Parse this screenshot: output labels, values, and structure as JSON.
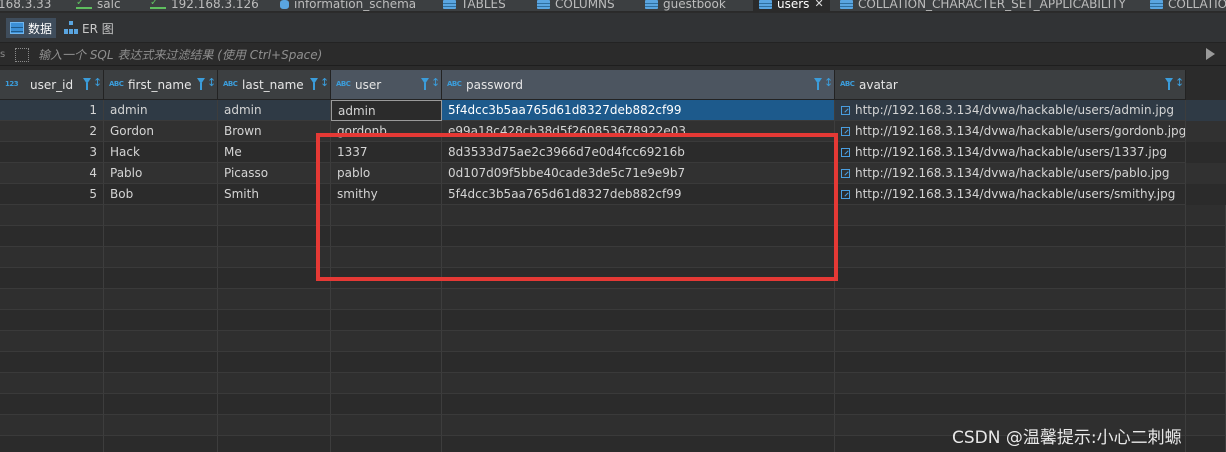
{
  "tabs": [
    {
      "label": "168.3.33",
      "icon": "connection-icon"
    },
    {
      "label": "salc",
      "icon": "connection-icon"
    },
    {
      "label": "192.168.3.126",
      "icon": "connection-icon"
    },
    {
      "label": "information_schema",
      "icon": "database-icon"
    },
    {
      "label": "TABLES",
      "icon": "table-icon"
    },
    {
      "label": "COLUMNS",
      "icon": "table-icon"
    },
    {
      "label": "guestbook",
      "icon": "table-icon"
    },
    {
      "label": "users",
      "icon": "table-icon",
      "active": true,
      "close": "✕"
    },
    {
      "label": "COLLATION_CHARACTER_SET_APPLICABILITY",
      "icon": "table-icon"
    },
    {
      "label": "COLLATIO",
      "icon": "table-icon"
    }
  ],
  "subtabs": {
    "data_label": "数据",
    "er_label": "ER 图"
  },
  "filter": {
    "prefix": "s",
    "placeholder": "输入一个 SQL 表达式来过滤结果 (使用 Ctrl+Space)"
  },
  "columns": [
    {
      "name": "user_id",
      "type_icon": "123"
    },
    {
      "name": "first_name",
      "type_icon": "ABC"
    },
    {
      "name": "last_name",
      "type_icon": "ABC"
    },
    {
      "name": "user",
      "type_icon": "ABC"
    },
    {
      "name": "password",
      "type_icon": "ABC"
    },
    {
      "name": "avatar",
      "type_icon": "ABC"
    }
  ],
  "rows": [
    {
      "user_id": "1",
      "first_name": "admin",
      "last_name": "admin",
      "user": "admin",
      "password": "5f4dcc3b5aa765d61d8327deb882cf99",
      "avatar": "http://192.168.3.134/dvwa/hackable/users/admin.jpg"
    },
    {
      "user_id": "2",
      "first_name": "Gordon",
      "last_name": "Brown",
      "user": "gordonb",
      "password": "e99a18c428cb38d5f260853678922e03",
      "avatar": "http://192.168.3.134/dvwa/hackable/users/gordonb.jpg"
    },
    {
      "user_id": "3",
      "first_name": "Hack",
      "last_name": "Me",
      "user": "1337",
      "password": "8d3533d75ae2c3966d7e0d4fcc69216b",
      "avatar": "http://192.168.3.134/dvwa/hackable/users/1337.jpg"
    },
    {
      "user_id": "4",
      "first_name": "Pablo",
      "last_name": "Picasso",
      "user": "pablo",
      "password": "0d107d09f5bbe40cade3de5c71e9e9b7",
      "avatar": "http://192.168.3.134/dvwa/hackable/users/pablo.jpg"
    },
    {
      "user_id": "5",
      "first_name": "Bob",
      "last_name": "Smith",
      "user": "smithy",
      "password": "5f4dcc3b5aa765d61d8327deb882cf99",
      "avatar": "http://192.168.3.134/dvwa/hackable/users/smithy.jpg"
    }
  ],
  "watermark": "CSDN @温馨提示:小心二刺螈",
  "colors": {
    "highlight": "#e53935",
    "selection": "#1d5a8c",
    "type_icon": "#3b9ddb"
  }
}
